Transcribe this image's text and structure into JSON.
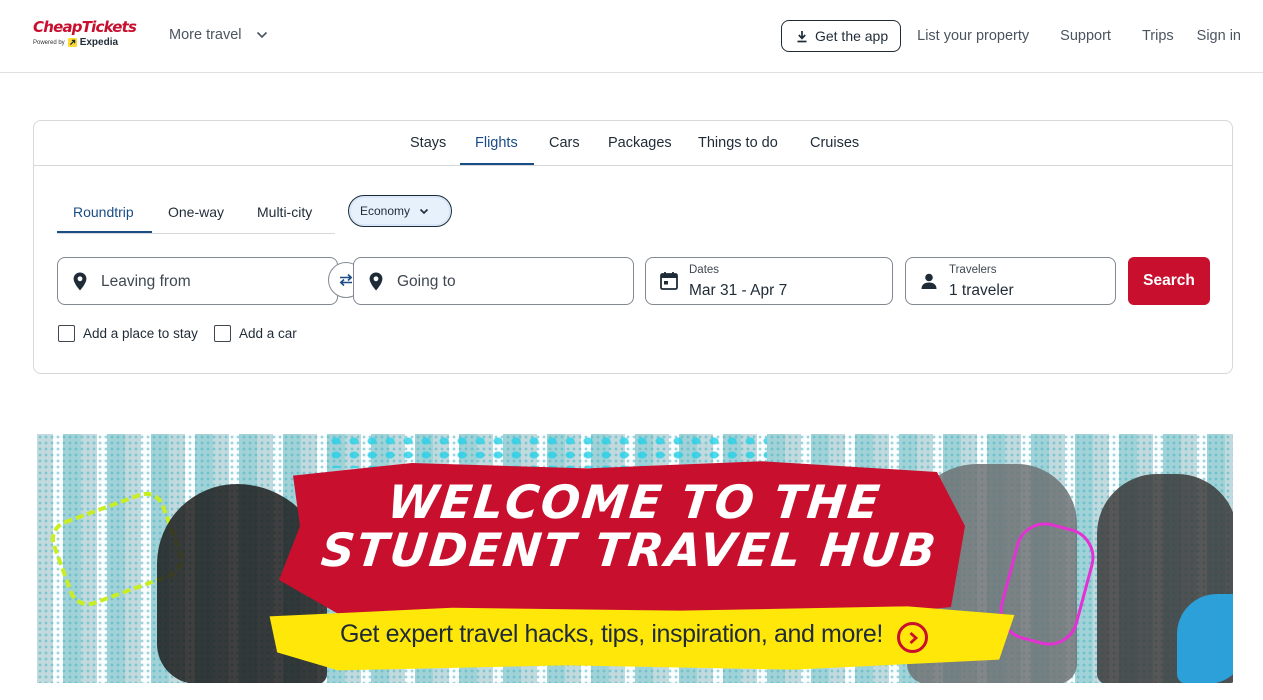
{
  "header": {
    "logo": {
      "brand": "CheapTickets",
      "powered_by": "Powered by",
      "partner": "Expedia"
    },
    "more_travel_label": "More travel",
    "get_app_label": "Get the app",
    "links": {
      "list_property": "List your property",
      "support": "Support",
      "trips": "Trips",
      "sign_in": "Sign in"
    }
  },
  "search": {
    "tabs": [
      "Stays",
      "Flights",
      "Cars",
      "Packages",
      "Things to do",
      "Cruises"
    ],
    "active_tab": "Flights",
    "trip_types": [
      "Roundtrip",
      "One-way",
      "Multi-city"
    ],
    "active_trip_type": "Roundtrip",
    "cabin_class": "Economy",
    "leaving_from_placeholder": "Leaving from",
    "going_to_placeholder": "Going to",
    "dates": {
      "label": "Dates",
      "value": "Mar 31 - Apr 7"
    },
    "travelers": {
      "label": "Travelers",
      "value": "1 traveler"
    },
    "search_button": "Search",
    "add_stay_label": "Add a place to stay",
    "add_car_label": "Add a car"
  },
  "banner": {
    "headline_line1": "WELCOME TO THE",
    "headline_line2": "STUDENT TRAVEL HUB",
    "subline": "Get expert travel hacks, tips, inspiration, and more!"
  },
  "colors": {
    "brand_red": "#c8102e",
    "link_blue": "#1a4d86",
    "banner_yellow": "#ffe70a"
  },
  "icons": [
    "download-icon",
    "chevron-down-icon",
    "location-pin-icon",
    "swap-icon",
    "calendar-icon",
    "person-icon",
    "arrow-right-circle-icon"
  ]
}
